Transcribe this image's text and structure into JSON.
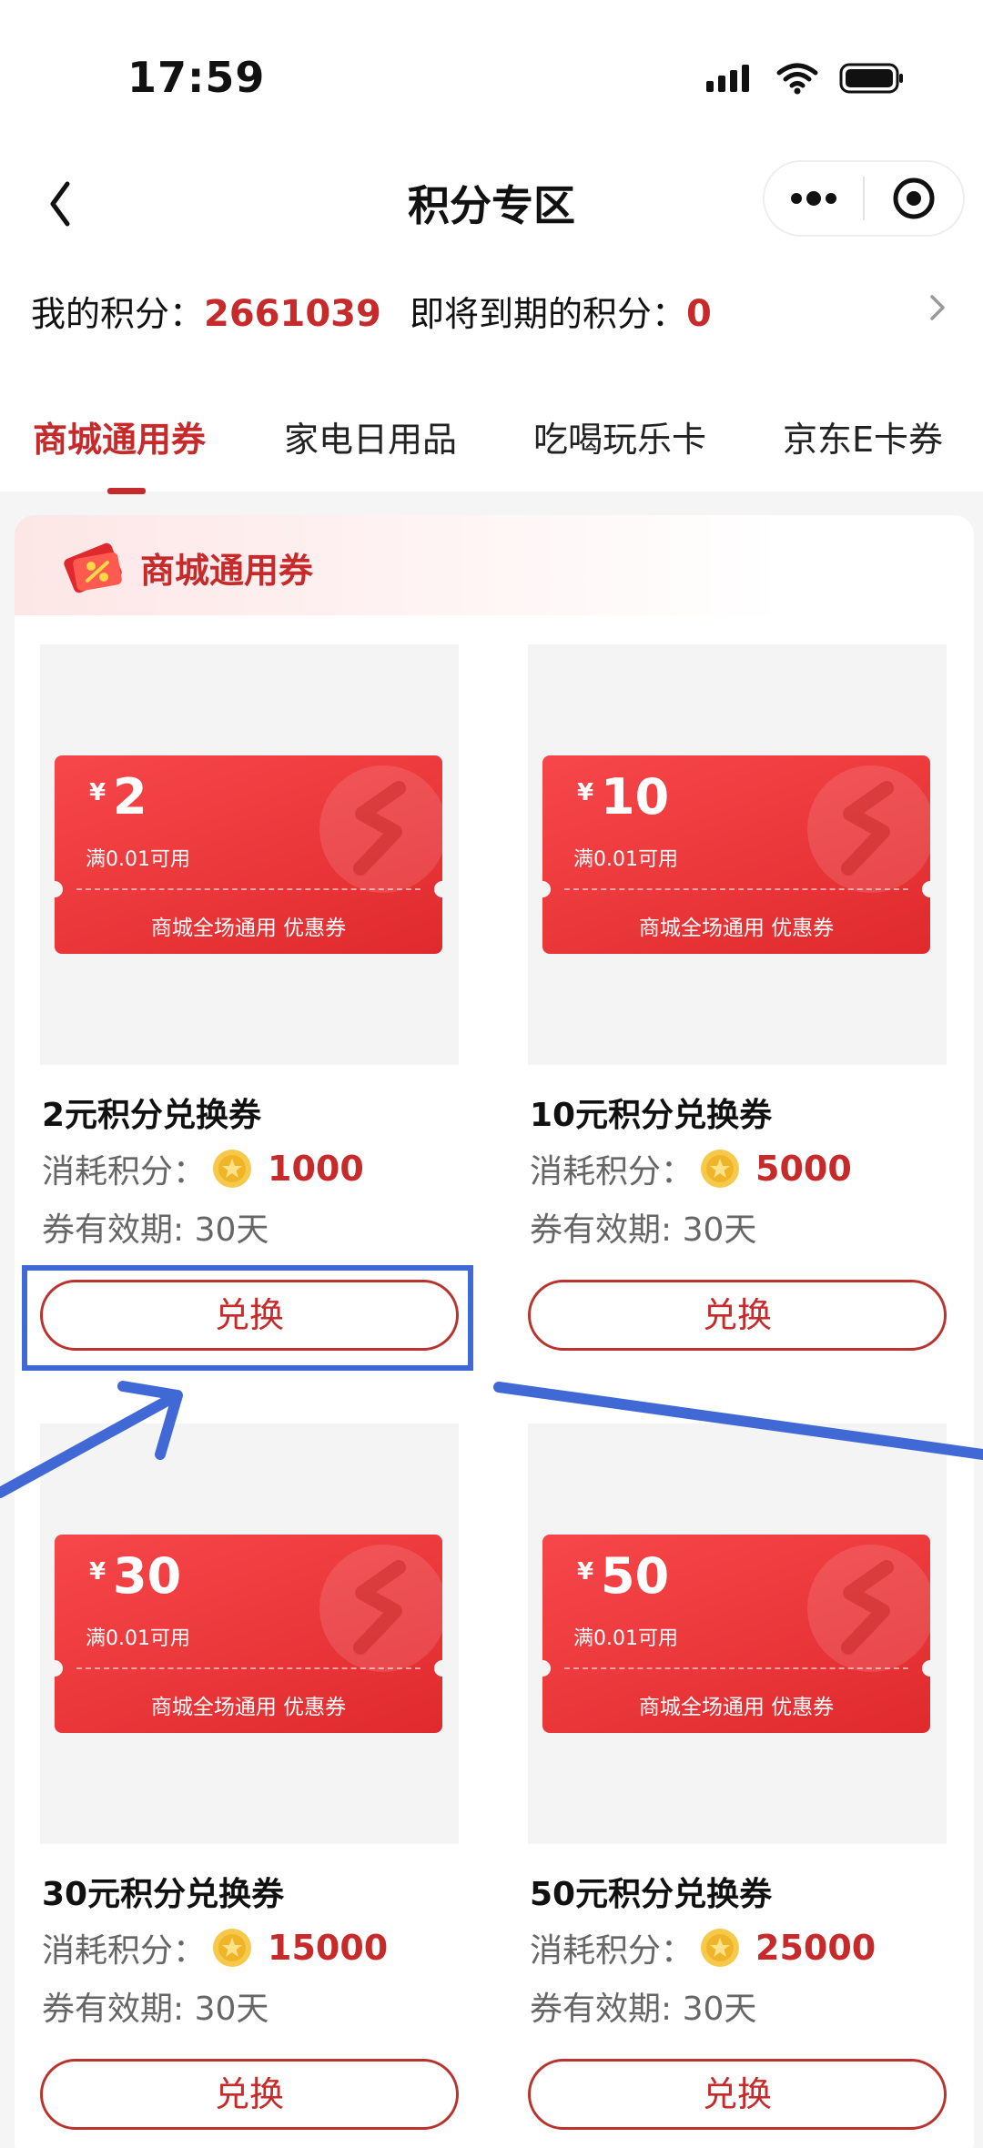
{
  "status_bar": {
    "time": "17:59"
  },
  "nav": {
    "title": "积分专区"
  },
  "points": {
    "my_label": "我的积分：",
    "my_value": "2661039",
    "expiring_label": "即将到期的积分：",
    "expiring_value": "0"
  },
  "tabs": [
    {
      "label": "商城通用券",
      "active": true
    },
    {
      "label": "家电日用品",
      "active": false
    },
    {
      "label": "吃喝玩乐卡",
      "active": false
    },
    {
      "label": "京东E卡券",
      "active": false
    }
  ],
  "section": {
    "title": "商城通用券"
  },
  "products": [
    {
      "yen": "¥",
      "amount": "2",
      "condition": "满0.01可用",
      "coupon_desc": "商城全场通用 优惠券",
      "name": "2元积分兑换券",
      "cost_label": "消耗积分：",
      "cost": "1000",
      "validity": "券有效期: 30天",
      "button": "兑换"
    },
    {
      "yen": "¥",
      "amount": "10",
      "condition": "满0.01可用",
      "coupon_desc": "商城全场通用 优惠券",
      "name": "10元积分兑换券",
      "cost_label": "消耗积分：",
      "cost": "5000",
      "validity": "券有效期: 30天",
      "button": "兑换"
    },
    {
      "yen": "¥",
      "amount": "30",
      "condition": "满0.01可用",
      "coupon_desc": "商城全场通用 优惠券",
      "name": "30元积分兑换券",
      "cost_label": "消耗积分：",
      "cost": "15000",
      "validity": "券有效期: 30天",
      "button": "兑换"
    },
    {
      "yen": "¥",
      "amount": "50",
      "condition": "满0.01可用",
      "coupon_desc": "商城全场通用 优惠券",
      "name": "50元积分兑换券",
      "cost_label": "消耗积分：",
      "cost": "25000",
      "validity": "券有效期: 30天",
      "button": "兑换"
    }
  ],
  "colors": {
    "accent": "#c62a2a",
    "coupon": "#ef3b3e",
    "annotation": "#4169d6"
  },
  "icons": [
    "back-chevron-icon",
    "more-dots-icon",
    "target-icon",
    "chevron-right-icon",
    "coupon-logo-icon",
    "coin-icon",
    "signal-icon",
    "wifi-icon",
    "battery-icon"
  ]
}
